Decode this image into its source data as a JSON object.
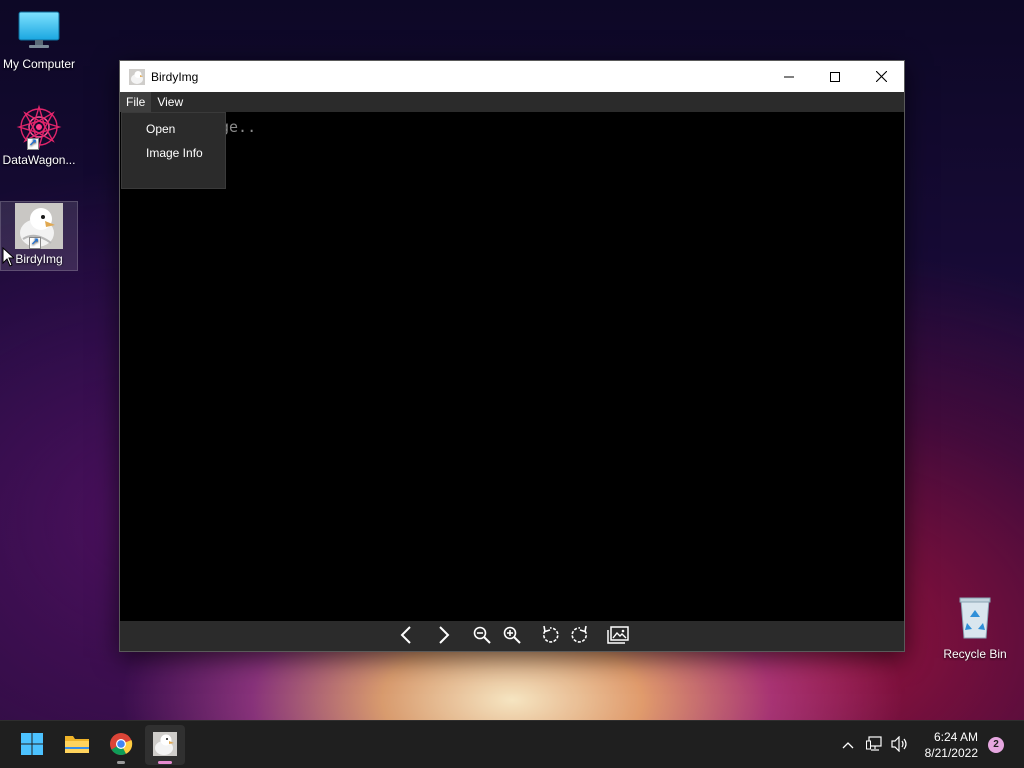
{
  "desktop": {
    "icons": [
      {
        "label": "My Computer",
        "icon": "monitor-icon"
      },
      {
        "label": "DataWagon...",
        "icon": "datawagon-icon"
      },
      {
        "label": "BirdyImg",
        "icon": "birdyimg-icon"
      },
      {
        "label": "Recycle Bin",
        "icon": "recycle-bin-icon"
      }
    ]
  },
  "window": {
    "title": "BirdyImg",
    "controls": {
      "minimize": "minimize-icon",
      "maximize": "maximize-icon",
      "close": "close-icon"
    },
    "menu": [
      {
        "label": "File"
      },
      {
        "label": "View"
      }
    ],
    "file_menu_open": true,
    "file_menu_items": [
      {
        "label": "Open"
      },
      {
        "label": "Image Info"
      }
    ],
    "placeholder_text": "ge..",
    "toolbar": [
      {
        "icon": "previous-icon"
      },
      {
        "icon": "next-icon"
      },
      {
        "icon": "zoom-out-icon"
      },
      {
        "icon": "zoom-in-icon"
      },
      {
        "icon": "rotate-left-icon"
      },
      {
        "icon": "rotate-right-icon"
      },
      {
        "icon": "gallery-icon"
      }
    ]
  },
  "taskbar": {
    "apps": [
      {
        "name": "Start",
        "icon": "windows-start-icon"
      },
      {
        "name": "File Explorer",
        "icon": "folder-icon"
      },
      {
        "name": "Chrome",
        "icon": "chrome-icon",
        "running": true
      },
      {
        "name": "BirdyImg",
        "icon": "birdyimg-icon",
        "running": true,
        "active": true
      }
    ],
    "tray": [
      "chevron-up-icon",
      "network-icon",
      "volume-icon"
    ],
    "time": "6:24 AM",
    "date": "8/21/2022",
    "notification_count": "2"
  },
  "colors": {
    "accent": "#e58bd0",
    "taskbar_bg": "#1f1f1f",
    "menubar_bg": "#2b2b2b",
    "window_bg": "#000000"
  }
}
